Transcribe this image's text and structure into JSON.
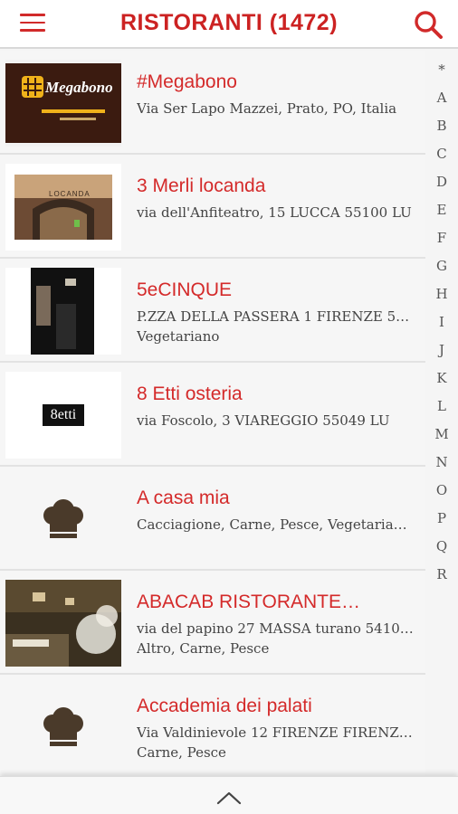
{
  "header": {
    "title": "RISTORANTI (1472)",
    "menu_icon": "hamburger-menu-icon",
    "search_icon": "search-icon",
    "accent_color": "#cc2222"
  },
  "restaurants": [
    {
      "name": "#Megabono",
      "address": "Via Ser Lapo Mazzei, Prato, PO, Italia",
      "tags": "",
      "thumb_text": "Megabono"
    },
    {
      "name": "3 Merli locanda",
      "address": "via dell'Anfiteatro, 15 LUCCA 55100 LU",
      "tags": "",
      "thumb_text": "LOCANDA"
    },
    {
      "name": "5eCINQUE",
      "address": "P.ZZA DELLA PASSERA 1 FIRENZE 50…",
      "tags": "Vegetariano"
    },
    {
      "name": "8 Etti osteria",
      "address": "via Foscolo, 3 VIAREGGIO 55049 LU",
      "tags": "",
      "thumb_text": "8etti"
    },
    {
      "name": "A casa mia",
      "address": "Cacciagione, Carne, Pesce, Vegetaria…",
      "tags": ""
    },
    {
      "name": "ABACAB RISTORANTE…",
      "address": "via del papino 27 MASSA turano 5410…",
      "tags": "Altro, Carne, Pesce"
    },
    {
      "name": "Accademia dei palati",
      "address": "Via Valdinievole 12 FIRENZE FIRENZ…",
      "tags": "Carne, Pesce"
    }
  ],
  "alphabet_index": [
    "*",
    "A",
    "B",
    "C",
    "D",
    "E",
    "F",
    "G",
    "H",
    "I",
    "J",
    "K",
    "L",
    "M",
    "N",
    "O",
    "P",
    "Q",
    "R"
  ],
  "footer": {
    "scroll_top_icon": "chevron-up-icon"
  }
}
